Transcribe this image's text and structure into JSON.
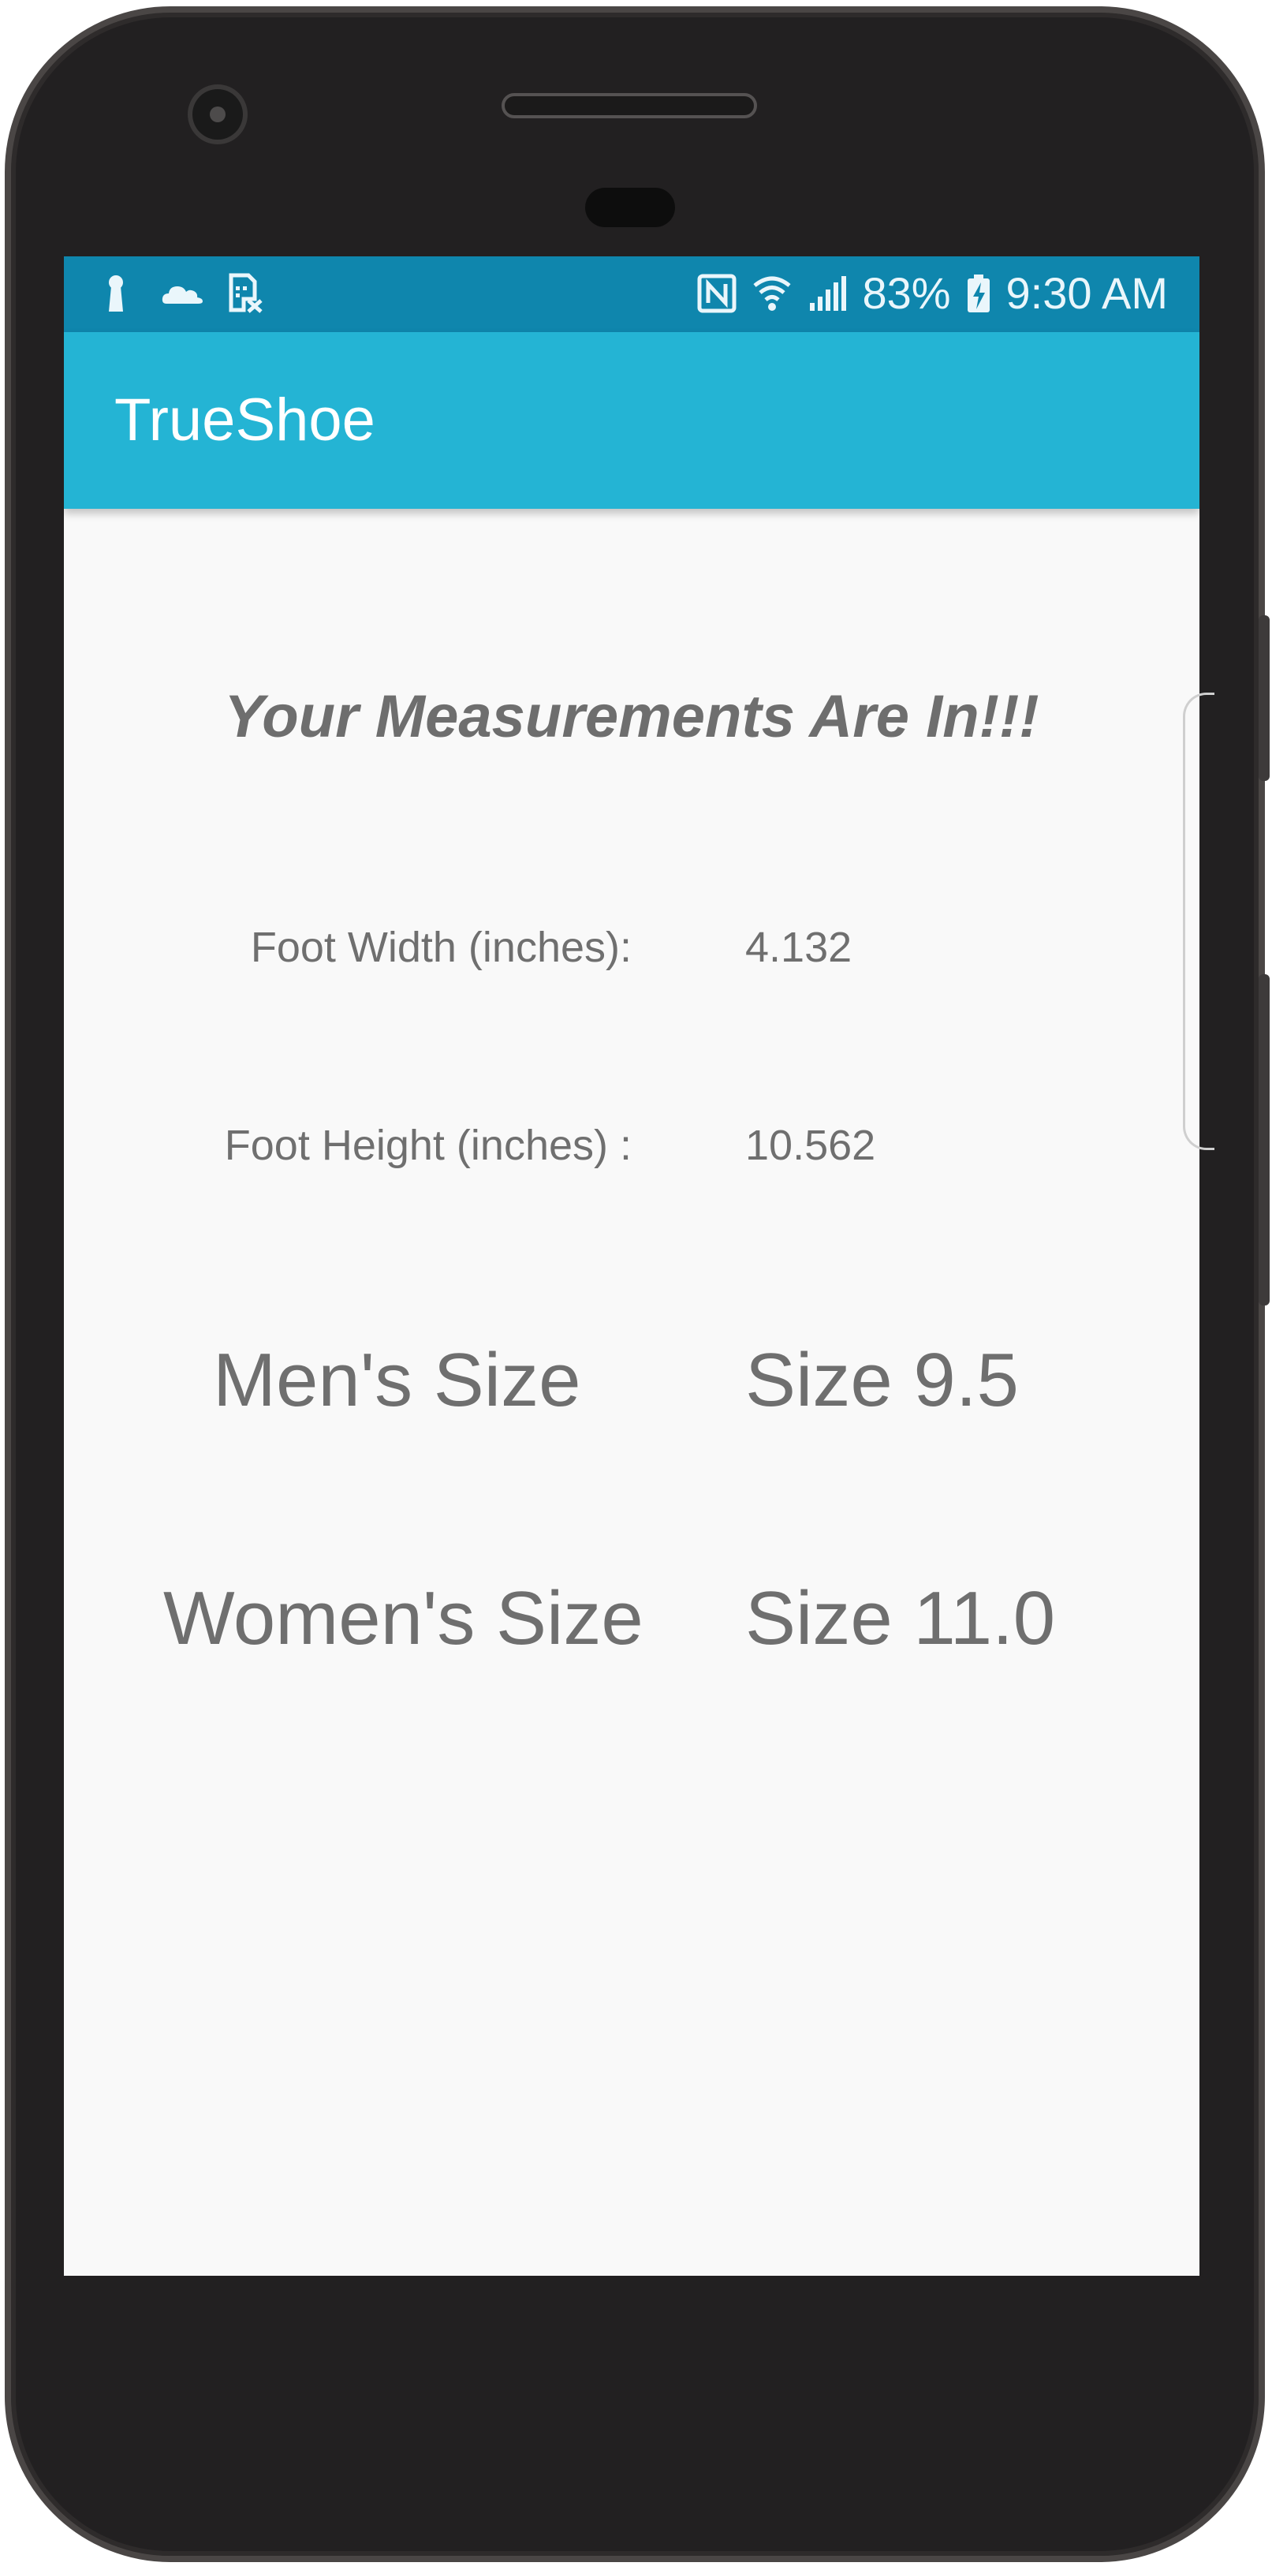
{
  "status_bar": {
    "left_icons": [
      "keyhole-icon",
      "cloud-icon",
      "sim-card-icon"
    ],
    "right_icons": [
      "nfc-icon",
      "wifi-icon",
      "signal-icon",
      "battery-charging-icon"
    ],
    "battery_percent": "83%",
    "time": "9:30 AM"
  },
  "app_bar": {
    "title": "TrueShoe"
  },
  "main": {
    "heading": "Your Measurements Are In!!!",
    "foot_width_label": "Foot Width (inches):",
    "foot_width_value": "4.132",
    "foot_height_label": "Foot Height (inches) :",
    "foot_height_value": "10.562",
    "mens_size_label": "Men's Size",
    "mens_size_value": "Size 9.5",
    "womens_size_label": "Women's Size",
    "womens_size_value": "Size 11.0"
  },
  "colors": {
    "status_bar": "#0f86ad",
    "app_bar": "#24b4d4",
    "background": "#f9f9f9",
    "text": "#6f6f6f"
  }
}
